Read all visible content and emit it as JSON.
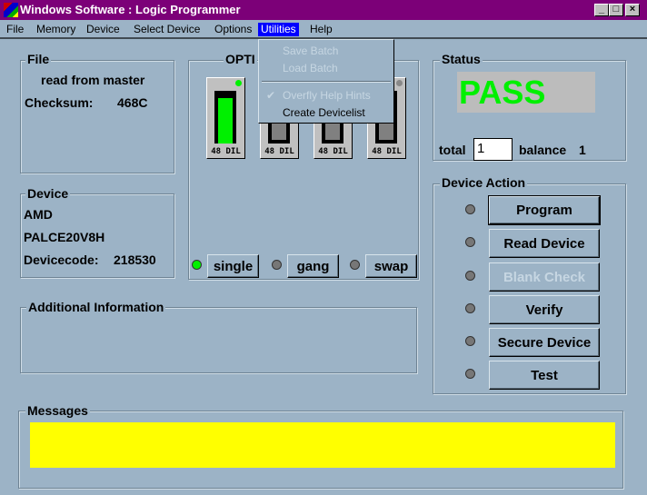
{
  "window": {
    "title": "Windows Software : Logic Programmer",
    "minimize": "_",
    "maximize": "□",
    "close": "×"
  },
  "menu": [
    "File",
    "Memory",
    "Device",
    "Select Device",
    "Options",
    "Utilities",
    "Help"
  ],
  "utilities_menu": {
    "items": [
      {
        "label": "Save Batch",
        "enabled": false
      },
      {
        "label": "Load Batch",
        "enabled": false
      },
      {
        "label": "Overfly Help Hints",
        "enabled": false,
        "checked": true
      },
      {
        "label": "Create Devicelist",
        "enabled": true
      }
    ],
    "check": "✔"
  },
  "file": {
    "legend": "File",
    "source": "read from master",
    "checksum_label": "Checksum:",
    "checksum": "468C"
  },
  "options": {
    "legend": "OPTI",
    "sockets": [
      "48 DIL",
      "48 DIL",
      "48 DIL",
      "48 DIL"
    ],
    "active_socket": 0,
    "modes": [
      "single",
      "gang",
      "swap"
    ],
    "active_mode": "single"
  },
  "device": {
    "legend": "Device",
    "manufacturer": "AMD",
    "part": "PALCE20V8H",
    "devicecode_label": "Devicecode:",
    "devicecode": "218530"
  },
  "additional": {
    "legend": "Additional Information"
  },
  "status": {
    "legend": "Status",
    "result": "PASS",
    "result_color": "#00f000",
    "total_label": "total",
    "total": "1",
    "balance_label": "balance",
    "balance": "1"
  },
  "device_action": {
    "legend": "Device Action",
    "buttons": [
      {
        "label": "Program",
        "enabled": true
      },
      {
        "label": "Read Device",
        "enabled": true
      },
      {
        "label": "Blank Check",
        "enabled": false
      },
      {
        "label": "Verify",
        "enabled": true
      },
      {
        "label": "Secure Device",
        "enabled": true
      },
      {
        "label": "Test",
        "enabled": true
      }
    ]
  },
  "messages": {
    "legend": "Messages",
    "color": "#ffff00"
  }
}
